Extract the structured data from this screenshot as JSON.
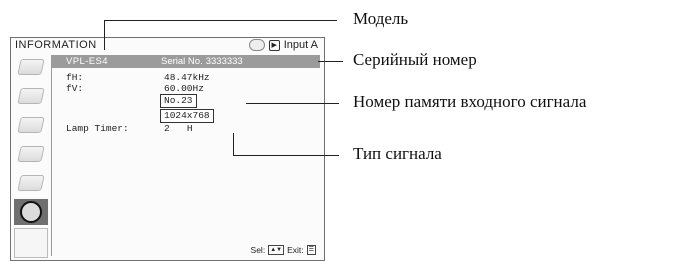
{
  "menu": {
    "title": "INFORMATION",
    "input_label": "Input A",
    "input_icon": "input-icon"
  },
  "info": {
    "model": "VPL-ES4",
    "serial_label": "Serial No.",
    "serial_value": "3333333",
    "fh_label": "fH:",
    "fh_value": "48.47kHz",
    "fv_label": "fV:",
    "fv_value": "60.00Hz",
    "memory_no": "No.23",
    "signal_type": "1024x768",
    "lamp_label": "Lamp Timer:",
    "lamp_value": "2",
    "lamp_unit": "H"
  },
  "footer": {
    "sel_label": "Sel:",
    "exit_label": "Exit:"
  },
  "callouts": {
    "model": "Модель",
    "serial": "Серийный номер",
    "memory": "Номер памяти входного сигнала",
    "signal_type": "Тип сигнала"
  },
  "sidebar_icons": [
    "picture-icon",
    "adjust-icon",
    "setup-icon",
    "menu-icon",
    "installation-icon",
    "information-icon",
    "blank"
  ]
}
